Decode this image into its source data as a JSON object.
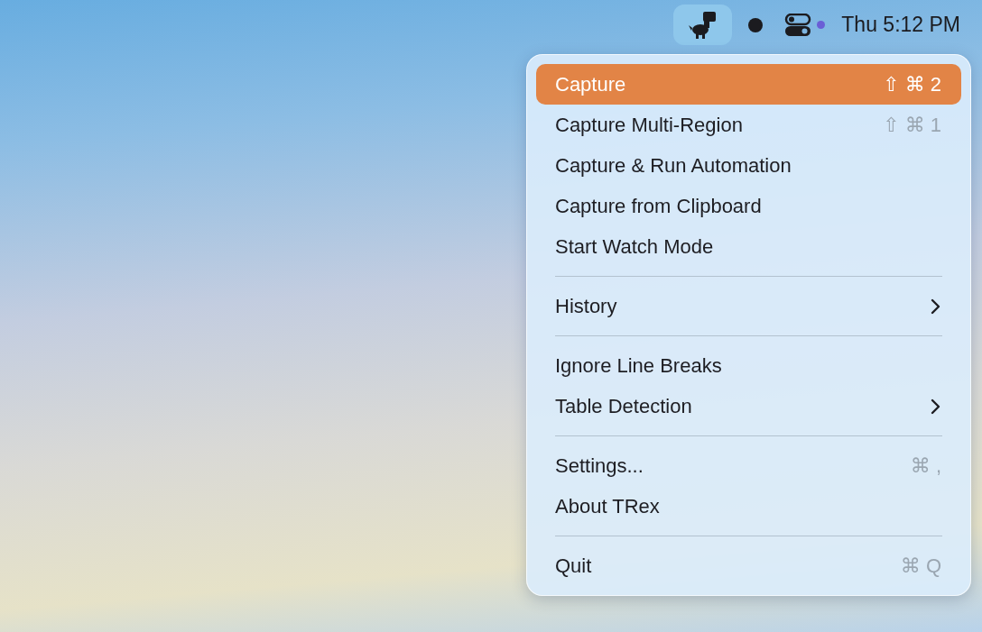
{
  "menu_bar": {
    "clock": "Thu 5:12 PM"
  },
  "menu": [
    {
      "kind": "item",
      "label": "Capture",
      "shortcut": "⇧ ⌘ 2",
      "selected": true
    },
    {
      "kind": "item",
      "label": "Capture Multi-Region",
      "shortcut": "⇧ ⌘ 1",
      "selected": false
    },
    {
      "kind": "item",
      "label": "Capture & Run Automation",
      "selected": false
    },
    {
      "kind": "item",
      "label": "Capture from Clipboard",
      "selected": false
    },
    {
      "kind": "item",
      "label": "Start Watch Mode",
      "selected": false
    },
    {
      "kind": "separator"
    },
    {
      "kind": "submenu",
      "label": "History",
      "selected": false
    },
    {
      "kind": "separator"
    },
    {
      "kind": "item",
      "label": "Ignore Line Breaks",
      "selected": false
    },
    {
      "kind": "submenu",
      "label": "Table Detection",
      "selected": false
    },
    {
      "kind": "separator"
    },
    {
      "kind": "item",
      "label": "Settings...",
      "shortcut": "⌘ ,",
      "selected": false
    },
    {
      "kind": "item",
      "label": "About TRex",
      "selected": false
    },
    {
      "kind": "separator"
    },
    {
      "kind": "item",
      "label": "Quit",
      "shortcut": "⌘ Q",
      "selected": false
    }
  ]
}
